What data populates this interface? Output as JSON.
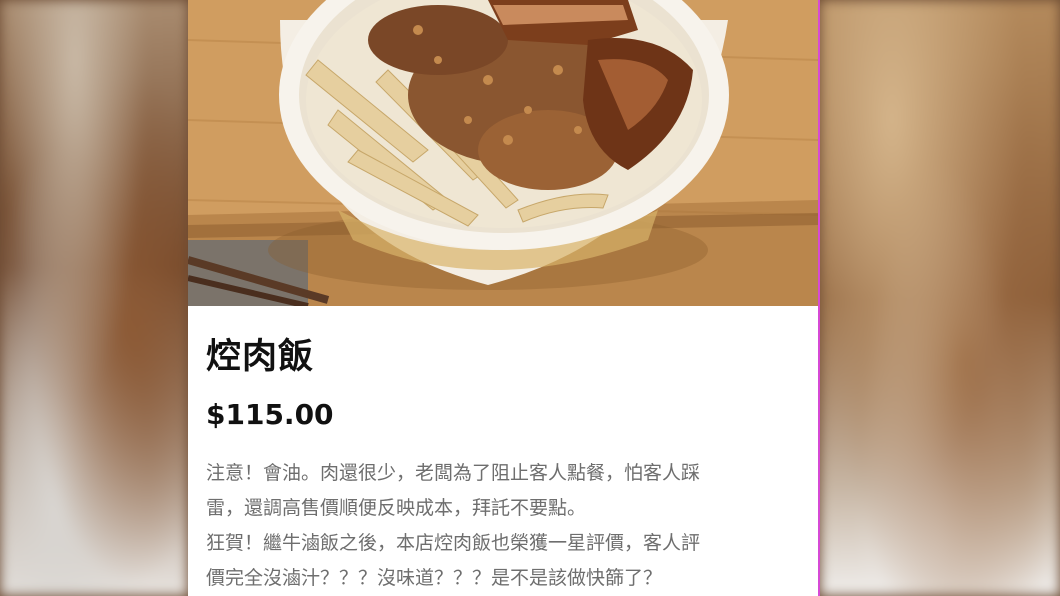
{
  "product": {
    "name": "焢肉飯",
    "price": "$115.00",
    "description_lines": [
      "注意！會油。肉還很少，老闆為了阻止客人點餐，怕客人踩",
      "雷，還調高售價順便反映成本，拜託不要點。",
      "狂賀！繼牛滷飯之後，本店焢肉飯也榮獲一星評價，客人評",
      "價完全沒滷汁？？？沒味道？？？是不是該做快篩了？"
    ]
  },
  "colors": {
    "accent_border": "#d64ad6",
    "title_text": "#111111",
    "description_text": "#6e6e6e"
  }
}
